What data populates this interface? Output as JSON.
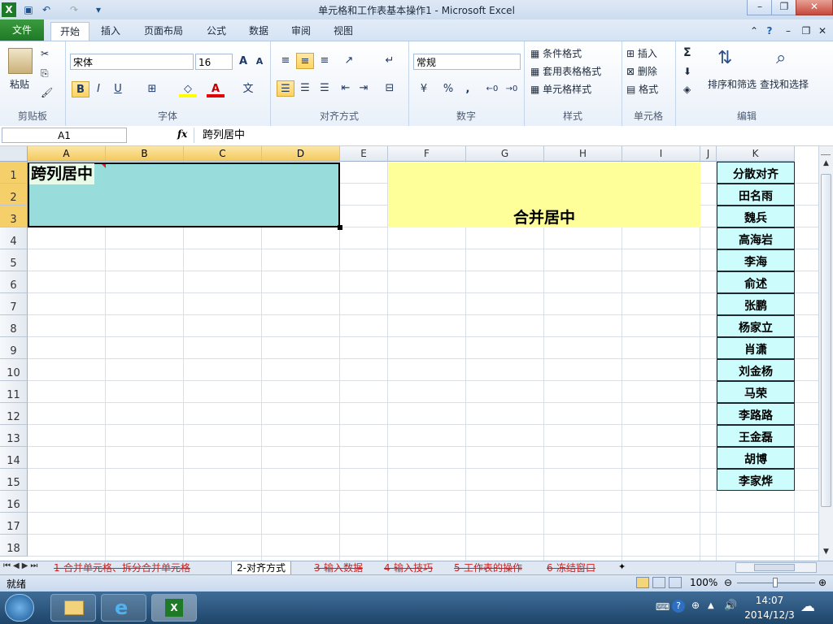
{
  "window": {
    "title": "单元格和工作表基本操作1 - Microsoft Excel"
  },
  "ribbon_tabs": [
    "文件",
    "开始",
    "插入",
    "页面布局",
    "公式",
    "数据",
    "审阅",
    "视图"
  ],
  "ribbon": {
    "clipboard": {
      "label": "剪贴板",
      "paste": "粘贴"
    },
    "font": {
      "label": "字体",
      "name": "宋体",
      "size": "16",
      "bold": "B",
      "italic": "I",
      "underline": "U"
    },
    "align": {
      "label": "对齐方式"
    },
    "number": {
      "label": "数字",
      "format": "常规",
      "percent": "%",
      "comma": ","
    },
    "styles": {
      "label": "样式",
      "cond": "条件格式",
      "table": "套用表格格式",
      "cell": "单元格样式"
    },
    "cells": {
      "label": "单元格",
      "insert": "插入",
      "delete": "删除",
      "format": "格式"
    },
    "edit": {
      "label": "编辑",
      "sum": "Σ",
      "sort": "排序和筛选",
      "find": "查找和选择"
    }
  },
  "formula_bar": {
    "name_box": "A1",
    "fx": "fx",
    "content": "跨列居中"
  },
  "columns": [
    "A",
    "B",
    "C",
    "D",
    "E",
    "F",
    "G",
    "H",
    "I",
    "J",
    "K"
  ],
  "rows": [
    "1",
    "2",
    "3",
    "4",
    "5",
    "6",
    "7",
    "8",
    "9",
    "10",
    "11",
    "12",
    "13",
    "14",
    "15",
    "16",
    "17",
    "18"
  ],
  "cells": {
    "a1": "跨列居中",
    "merged": "合并居中",
    "k_col": [
      "分散对齐",
      "田名雨",
      "魏兵",
      "高海岩",
      "李海",
      "俞述",
      "张鹏",
      "杨家立",
      "肖潇",
      "刘金杨",
      "马荣",
      "李路路",
      "王金磊",
      "胡博",
      "李家烨"
    ]
  },
  "colors": {
    "a1_fill": "#99dcdc",
    "merged_fill": "#ffff99",
    "k_fill": "#ccfcfc"
  },
  "sheet_tabs": [
    "1-合并单元格、拆分合并单元格",
    "2-对齐方式",
    "3-输入数据",
    "4-输入技巧",
    "5-工作表的操作",
    "6-冻结窗口"
  ],
  "status": {
    "ready": "就绪",
    "zoom": "100%"
  },
  "taskbar": {
    "time": "14:07",
    "date": "2014/12/3"
  }
}
